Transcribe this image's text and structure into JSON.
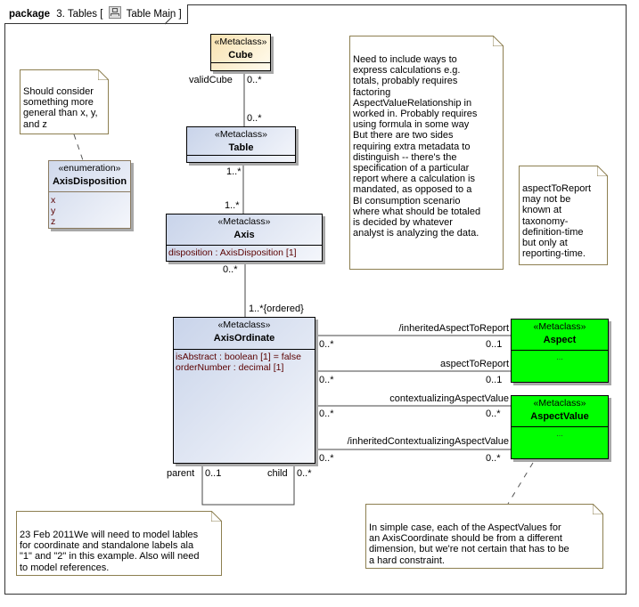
{
  "package": {
    "keyword": "package",
    "name": "3. Tables [",
    "diagram_icon": "class-diagram-icon",
    "diagram_name": "Table Main ]"
  },
  "classes": {
    "cube": {
      "stereotype": "«Metaclass»",
      "name": "Cube"
    },
    "table": {
      "stereotype": "«Metaclass»",
      "name": "Table"
    },
    "axis": {
      "stereotype": "«Metaclass»",
      "name": "Axis",
      "attributes": [
        "disposition : AxisDisposition [1]"
      ]
    },
    "axis_ordinate": {
      "stereotype": "«Metaclass»",
      "name": "AxisOrdinate",
      "attributes": [
        "isAbstract : boolean [1] = false",
        "orderNumber : decimal [1]"
      ]
    },
    "aspect": {
      "stereotype": "«Metaclass»",
      "name": "Aspect",
      "body": "..."
    },
    "aspect_value": {
      "stereotype": "«Metaclass»",
      "name": "AspectValue",
      "body": "..."
    },
    "axis_disposition": {
      "stereotype": "«enumeration»",
      "name": "AxisDisposition",
      "literals": [
        "x",
        "y",
        "z"
      ]
    }
  },
  "associations": {
    "cube_table": {
      "role": "validCube",
      "cube_end": "0..*",
      "table_end": "0..*"
    },
    "table_axis": {
      "table_end": "1..*",
      "axis_end": "1..*"
    },
    "axis_ordinate": {
      "axis_end": "0..*",
      "ordinate_end": "1..*{ordered}"
    },
    "inherited_aspect": {
      "role": "/inheritedAspectToReport",
      "source": "0..*",
      "target": "0..1"
    },
    "aspect_to_report": {
      "role": "aspectToReport",
      "source": "0..*",
      "target": "0..1"
    },
    "contextualizing": {
      "role": "contextualizingAspectValue",
      "source": "0..*",
      "target": "0..*"
    },
    "inherited_contextualizing": {
      "role": "/inheritedContextualizingAspectValue",
      "source": "0..*",
      "target": "0..*"
    },
    "self": {
      "parent_role": "parent",
      "parent_mult": "0..1",
      "child_role": "child",
      "child_mult": "0..*"
    }
  },
  "notes": {
    "axis_disposition_note": "Should consider\nsomething more\ngeneral than x, y,\nand z",
    "calculation_note": "Need to include ways to\nexpress calculations e.g.\ntotals, probably requires\nfactoring\nAspectValueRelationship in\nworked in.  Probably requires\nusing formula in some way\nBut there are two sides\nrequiring extra metadata to\ndistinguish -- there's the\nspecification of a particular\nreport where a calculation is\nmandated, as opposed to a\nBI consumption scenario\nwhere what should be totaled\nis decided by whatever\nanalyst is analyzing the data.",
    "aspect_note": "aspectToReport\nmay not be\nknown at\ntaxonomy-\ndefinition-time\nbut only at\nreporting-time.",
    "labels_note": "23 Feb 2011We will need to model lables\nfor coordinate and standalone labels ala\n\"1\" and \"2\" in this example.  Also will need\nto model references.",
    "aspect_value_note": "In simple case, each of the AspectValues for\nan AxisCoordinate should be from a different\ndimension, but we're not certain that has to be\na hard constraint."
  }
}
